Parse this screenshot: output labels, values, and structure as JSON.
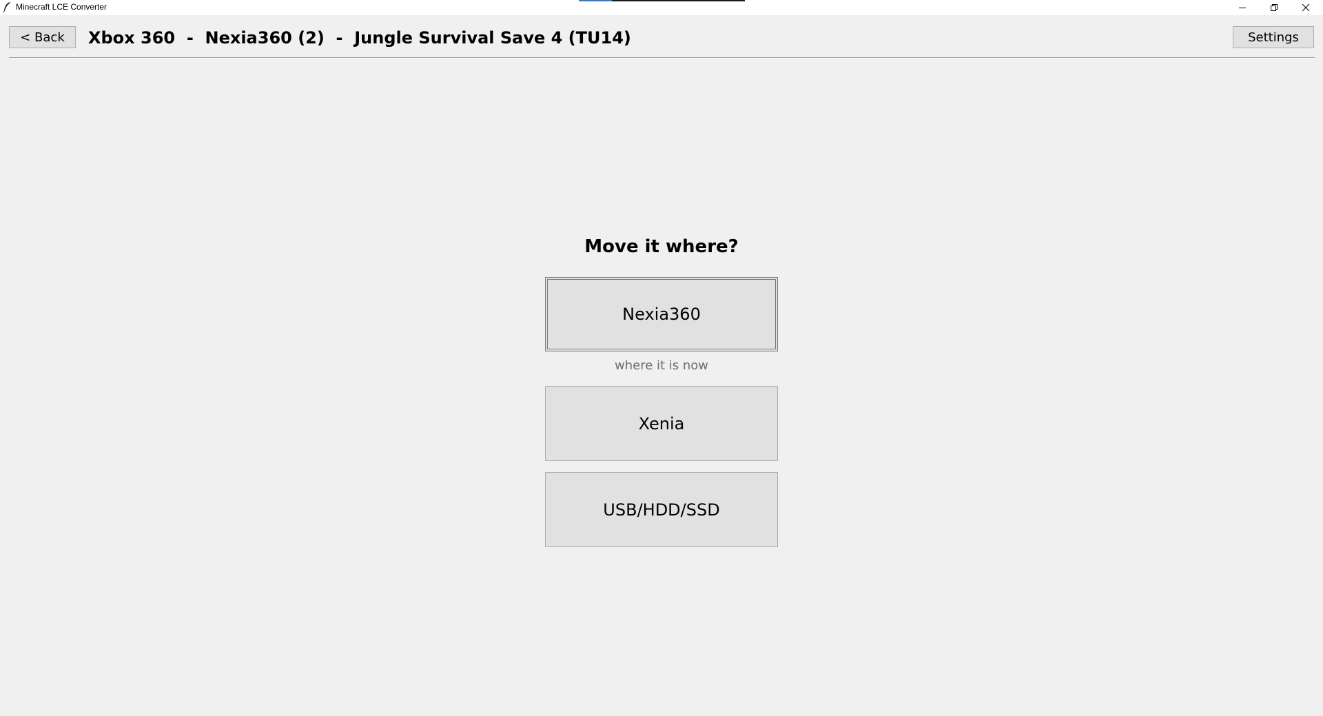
{
  "window": {
    "title": "Minecraft LCE Converter",
    "controls": {
      "minimize_icon": "minimize-icon",
      "restore_icon": "restore-icon",
      "close_icon": "close-icon"
    }
  },
  "header": {
    "back_label": "< Back",
    "title": "Xbox 360  -  Nexia360 (2)  -  Jungle Survival Save 4 (TU14)",
    "settings_label": "Settings"
  },
  "main": {
    "prompt": "Move it where?",
    "options": [
      {
        "label": "Nexia360",
        "caption": "where it is now"
      },
      {
        "label": "Xenia"
      },
      {
        "label": "USB/HDD/SSD"
      }
    ]
  },
  "colors": {
    "background": "#f0f0f0",
    "button_face": "#e1e1e1",
    "button_border": "#adadad",
    "caption_text": "#6d6d6d",
    "accent": "#2b7bd6"
  }
}
